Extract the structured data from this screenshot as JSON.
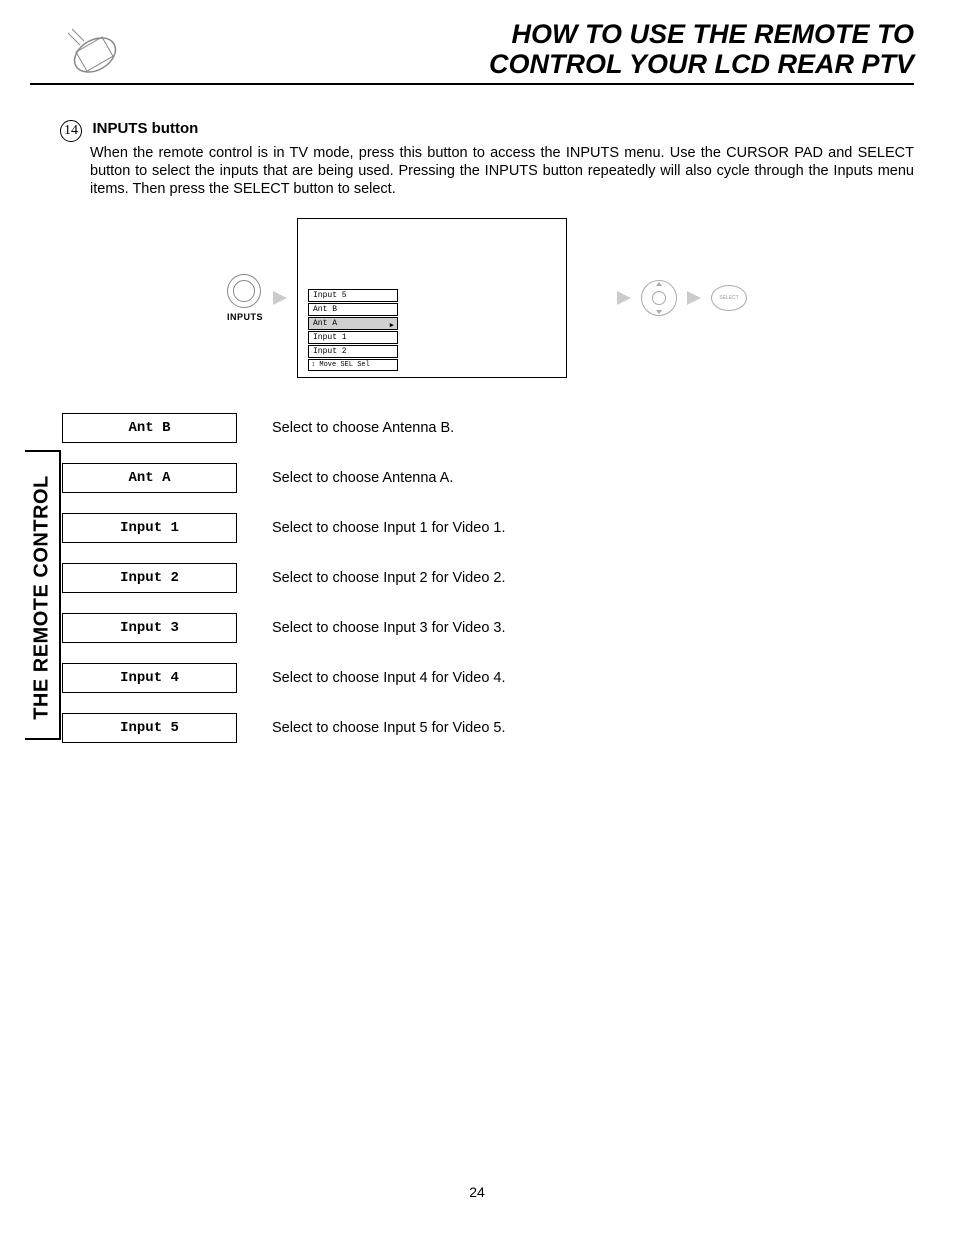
{
  "header": {
    "line1": "HOW TO USE THE REMOTE TO",
    "line2": "CONTROL YOUR LCD REAR PTV"
  },
  "side_tab": "THE REMOTE CONTROL",
  "section": {
    "number": "14",
    "title": "INPUTS button",
    "body": "When the remote control is in TV mode, press this button to access the INPUTS menu.  Use the CURSOR PAD and SELECT button to select the inputs that are being used.  Pressing the INPUTS button repeatedly will also cycle through the Inputs menu items.  Then press the SELECT button to select."
  },
  "diagram": {
    "button_label": "INPUTS",
    "menu_items": [
      "Input 5",
      "Ant B",
      "Ant A",
      "Input 1",
      "Input 2"
    ],
    "selected_index": 2,
    "menu_footer": "Move  SEL  Sel",
    "select_label": "SELECT"
  },
  "input_rows": [
    {
      "label": "Ant B",
      "desc": "Select to choose Antenna B."
    },
    {
      "label": "Ant A",
      "desc": "Select to choose Antenna A."
    },
    {
      "label": "Input 1",
      "desc": "Select to choose Input 1 for Video 1."
    },
    {
      "label": "Input 2",
      "desc": "Select to choose Input 2 for Video 2."
    },
    {
      "label": "Input 3",
      "desc": "Select to choose Input 3 for Video 3."
    },
    {
      "label": "Input 4",
      "desc": "Select to choose Input 4 for Video 4."
    },
    {
      "label": "Input 5",
      "desc": "Select to choose Input 5 for Video 5."
    }
  ],
  "page_number": "24"
}
